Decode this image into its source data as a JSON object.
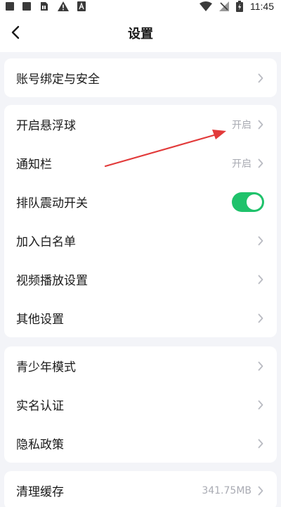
{
  "status_bar": {
    "time": "11:45",
    "icons": [
      "app-icon",
      "app-icon",
      "sim-icon",
      "warning-icon",
      "a-icon",
      "wifi-icon",
      "no-signal-icon",
      "battery-charging-icon"
    ]
  },
  "nav": {
    "title": "设置",
    "back_icon": "chevron-left-icon"
  },
  "groups": [
    {
      "items": [
        {
          "label": "账号绑定与安全",
          "control": "chevron"
        }
      ]
    },
    {
      "items": [
        {
          "label": "开启悬浮球",
          "value": "开启",
          "control": "chevron"
        },
        {
          "label": "通知栏",
          "value": "开启",
          "control": "chevron"
        },
        {
          "label": "排队震动开关",
          "control": "toggle",
          "toggle_on": true
        },
        {
          "label": "加入白名单",
          "control": "chevron"
        },
        {
          "label": "视频播放设置",
          "control": "chevron"
        },
        {
          "label": "其他设置",
          "control": "chevron"
        }
      ]
    },
    {
      "items": [
        {
          "label": "青少年模式",
          "control": "chevron"
        },
        {
          "label": "实名认证",
          "control": "chevron"
        },
        {
          "label": "隐私政策",
          "control": "chevron"
        }
      ]
    },
    {
      "items": [
        {
          "label": "清理缓存",
          "value": "341.75MB",
          "control": "chevron"
        }
      ]
    }
  ],
  "colors": {
    "background": "#f3f4f8",
    "card": "#ffffff",
    "toggle_on": "#1fc26b",
    "annotation_arrow": "#e23a3a",
    "muted_text": "#a9abb3",
    "chevron": "#b9bbc2"
  }
}
